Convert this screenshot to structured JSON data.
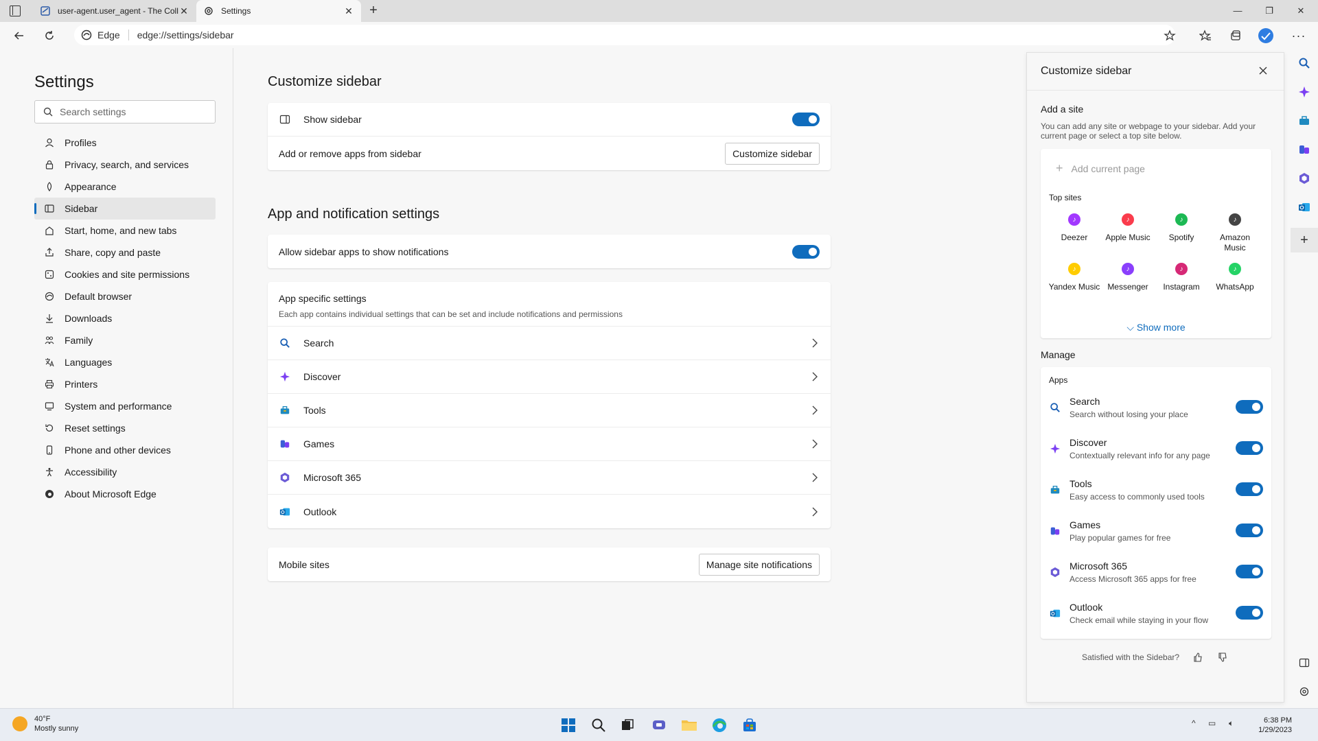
{
  "tabs": [
    {
      "title": "user-agent.user_agent - The Coll",
      "active": false
    },
    {
      "title": "Settings",
      "active": true
    }
  ],
  "address": {
    "chip": "Edge",
    "url": "edge://settings/sidebar"
  },
  "nav": {
    "title": "Settings",
    "search_placeholder": "Search settings",
    "items": [
      {
        "label": "Profiles",
        "icon": "person-icon"
      },
      {
        "label": "Privacy, search, and services",
        "icon": "lock-icon"
      },
      {
        "label": "Appearance",
        "icon": "appearance-icon"
      },
      {
        "label": "Sidebar",
        "icon": "sidebar-icon",
        "active": true
      },
      {
        "label": "Start, home, and new tabs",
        "icon": "home-icon"
      },
      {
        "label": "Share, copy and paste",
        "icon": "share-icon"
      },
      {
        "label": "Cookies and site permissions",
        "icon": "cookie-icon"
      },
      {
        "label": "Default browser",
        "icon": "browser-icon"
      },
      {
        "label": "Downloads",
        "icon": "download-icon"
      },
      {
        "label": "Family",
        "icon": "family-icon"
      },
      {
        "label": "Languages",
        "icon": "language-icon"
      },
      {
        "label": "Printers",
        "icon": "printer-icon"
      },
      {
        "label": "System and performance",
        "icon": "system-icon"
      },
      {
        "label": "Reset settings",
        "icon": "reset-icon"
      },
      {
        "label": "Phone and other devices",
        "icon": "phone-icon"
      },
      {
        "label": "Accessibility",
        "icon": "accessibility-icon"
      },
      {
        "label": "About Microsoft Edge",
        "icon": "edge-icon"
      }
    ]
  },
  "main": {
    "customize_title": "Customize sidebar",
    "show_sidebar": "Show sidebar",
    "add_remove": "Add or remove apps from sidebar",
    "customize_button": "Customize sidebar",
    "app_notif_title": "App and notification settings",
    "allow_notif": "Allow sidebar apps to show notifications",
    "app_specific_title": "App specific settings",
    "app_specific_desc": "Each app contains individual settings that can be set and include notifications and permissions",
    "apps": [
      "Search",
      "Discover",
      "Tools",
      "Games",
      "Microsoft 365",
      "Outlook"
    ],
    "mobile_sites": "Mobile sites",
    "manage_notif_button": "Manage site notifications"
  },
  "panel": {
    "title": "Customize sidebar",
    "add_site": "Add a site",
    "add_site_desc": "You can add any site or webpage to your sidebar. Add your current page or select a top site below.",
    "add_current": "Add current page",
    "top_sites_label": "Top sites",
    "top_sites": [
      {
        "name": "Deezer",
        "color": "#a238ff"
      },
      {
        "name": "Apple Music",
        "color": "#fa3c4c"
      },
      {
        "name": "Spotify",
        "color": "#1db954"
      },
      {
        "name": "Amazon Music",
        "color": "#444444"
      },
      {
        "name": "Yandex Music",
        "color": "#ffcc00"
      },
      {
        "name": "Messenger",
        "color": "#8a3ffc"
      },
      {
        "name": "Instagram",
        "color": "#d62976"
      },
      {
        "name": "WhatsApp",
        "color": "#25d366"
      }
    ],
    "show_more": "Show more",
    "manage": "Manage",
    "apps_label": "Apps",
    "apps": [
      {
        "name": "Search",
        "sub": "Search without losing your place"
      },
      {
        "name": "Discover",
        "sub": "Contextually relevant info for any page"
      },
      {
        "name": "Tools",
        "sub": "Easy access to commonly used tools"
      },
      {
        "name": "Games",
        "sub": "Play popular games for free"
      },
      {
        "name": "Microsoft 365",
        "sub": "Access Microsoft 365 apps for free"
      },
      {
        "name": "Outlook",
        "sub": "Check email while staying in your flow"
      }
    ],
    "feedback": "Satisfied with the Sidebar?"
  },
  "taskbar": {
    "temp": "40°F",
    "condition": "Mostly sunny",
    "time": "6:38 PM",
    "date": "1/29/2023"
  },
  "colors": {
    "accent": "#0f6cbd"
  }
}
